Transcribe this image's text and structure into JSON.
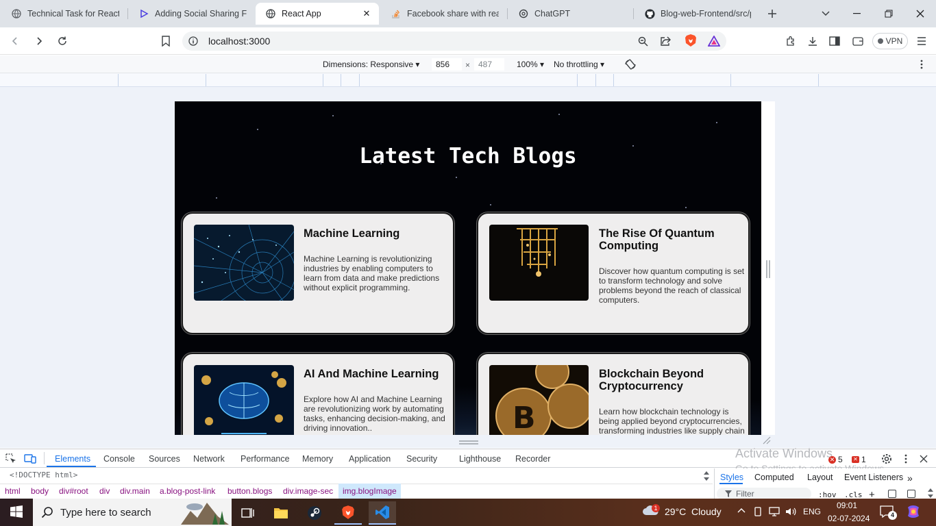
{
  "browser": {
    "tabs": [
      {
        "title": "Technical Task for React JS",
        "icon": "globe-icon"
      },
      {
        "title": "Adding Social Sharing Fea",
        "icon": "play-icon"
      },
      {
        "title": "React App",
        "icon": "globe-icon",
        "active": true
      },
      {
        "title": "Facebook share with react",
        "icon": "stackoverflow-icon"
      },
      {
        "title": "ChatGPT",
        "icon": "chatgpt-icon"
      },
      {
        "title": "Blog-web-Frontend/src/pa",
        "icon": "github-icon"
      }
    ],
    "url": "localhost:3000",
    "vpn_label": "VPN"
  },
  "device_toolbar": {
    "dimensions_label": "Dimensions: Responsive",
    "width": "856",
    "height": "487",
    "zoom": "100%",
    "throttling": "No throttling",
    "times": "×"
  },
  "app": {
    "title": "Latest Tech Blogs",
    "cards": [
      {
        "title": "Machine Learning",
        "description": "Machine Learning is revolutionizing industries by enabling computers to learn from data and make predictions without explicit programming."
      },
      {
        "title": "The Rise Of Quantum Computing",
        "description": "Discover how quantum computing is set to transform technology and solve problems beyond the reach of classical computers."
      },
      {
        "title": "AI And Machine Learning",
        "description": "Explore how AI and Machine Learning are revolutionizing work by automating tasks, enhancing decision-making, and driving innovation.."
      },
      {
        "title": "Blockchain Beyond Cryptocurrency",
        "description": "Learn how blockchain technology is being applied beyond cryptocurrencies, transforming industries like supply chain"
      }
    ]
  },
  "devtools": {
    "tabs": [
      "Elements",
      "Console",
      "Sources",
      "Network",
      "Performance",
      "Memory",
      "Application",
      "Security",
      "Lighthouse",
      "Recorder"
    ],
    "active_tab": "Elements",
    "doctype": "<!DOCTYPE html>",
    "breadcrumbs": [
      "html",
      "body",
      "div#root",
      "div",
      "div.main",
      "a.blog-post-link",
      "button.blogs",
      "div.image-sec",
      "img.blogImage"
    ],
    "styles_tabs": [
      "Styles",
      "Computed",
      "Layout",
      "Event Listeners"
    ],
    "filter_placeholder": "Filter",
    "hov": ":hov",
    "cls": ".cls",
    "error_count": "5",
    "warning_count": "1",
    "watermark_title": "Activate Windows",
    "watermark_sub": "Go to Settings to activate Windows."
  },
  "taskbar": {
    "search_placeholder": "Type here to search",
    "weather": "29°C  Cloudy",
    "weather_badge": "1",
    "language": "ENG",
    "time": "09:01",
    "date": "02-07-2024",
    "notification_count": "4"
  }
}
